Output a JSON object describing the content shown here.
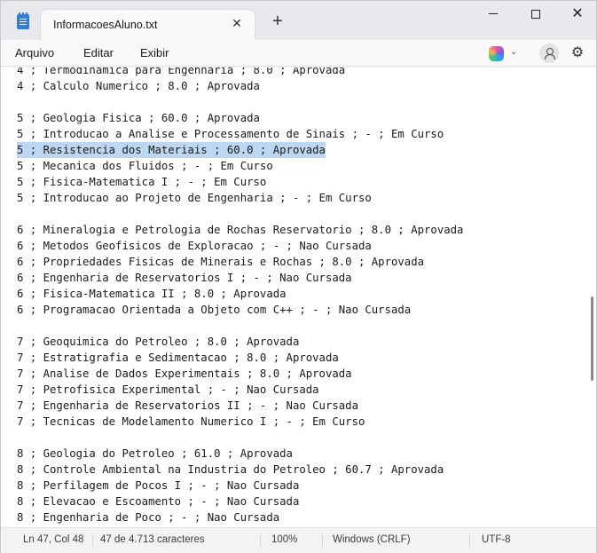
{
  "window": {
    "tab_title": "InformacoesAluno.txt",
    "tab_close": "✕",
    "new_tab": "+",
    "min": "",
    "max": "",
    "close": "✕"
  },
  "menu": {
    "items": [
      "Arquivo",
      "Editar",
      "Exibir"
    ],
    "copilot_chevron": "⌄",
    "gear": "⚙"
  },
  "editor": {
    "lines": [
      "4 ; Termodinamica para Engenharia ; 8.0 ; Aprovada",
      "4 ; Calculo Numerico ; 8.0 ; Aprovada",
      "",
      "5 ; Geologia Fisica ; 60.0 ; Aprovada",
      "5 ; Introducao a Analise e Processamento de Sinais ; - ; Em Curso",
      "5 ; Resistencia dos Materiais ; 60.0 ; Aprovada",
      "5 ; Mecanica dos Fluidos ; - ; Em Curso",
      "5 ; Fisica-Matematica I ; - ; Em Curso",
      "5 ; Introducao ao Projeto de Engenharia ; - ; Em Curso",
      "",
      "6 ; Mineralogia e Petrologia de Rochas Reservatorio ; 8.0 ; Aprovada",
      "6 ; Metodos Geofisicos de Exploracao ; - ; Nao Cursada",
      "6 ; Propriedades Fisicas de Minerais e Rochas ; 8.0 ; Aprovada",
      "6 ; Engenharia de Reservatorios I ; - ; Nao Cursada",
      "6 ; Fisica-Matematica II ; 8.0 ; Aprovada",
      "6 ; Programacao Orientada a Objeto com C++ ; - ; Nao Cursada",
      "",
      "7 ; Geoquimica do Petroleo ; 8.0 ; Aprovada",
      "7 ; Estratigrafia e Sedimentacao ; 8.0 ; Aprovada",
      "7 ; Analise de Dados Experimentais ; 8.0 ; Aprovada",
      "7 ; Petrofisica Experimental ; - ; Nao Cursada",
      "7 ; Engenharia de Reservatorios II ; - ; Nao Cursada",
      "7 ; Tecnicas de Modelamento Numerico I ; - ; Em Curso",
      "",
      "8 ; Geologia do Petroleo ; 61.0 ; Aprovada",
      "8 ; Controle Ambiental na Industria do Petroleo ; 60.7 ; Aprovada",
      "8 ; Perfilagem de Pocos I ; - ; Nao Cursada",
      "8 ; Elevacao e Escoamento ; - ; Nao Cursada",
      "8 ; Engenharia de Poco ; - ; Nao Cursada"
    ],
    "selected_line_index": 5
  },
  "status": {
    "position": "Ln 47, Col 48",
    "chars": "47 de 4.713 caracteres",
    "zoom": "100%",
    "line_ending": "Windows (CRLF)",
    "encoding": "UTF-8"
  }
}
